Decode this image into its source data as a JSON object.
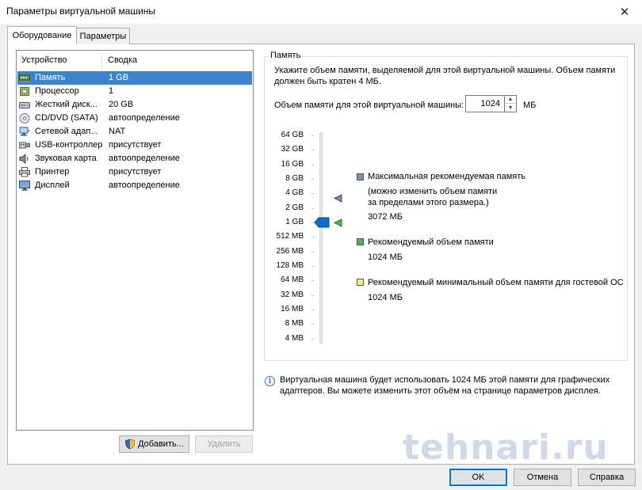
{
  "window": {
    "title": "Параметры виртуальной машины",
    "close_glyph": "✕"
  },
  "tabs": [
    {
      "label": "Оборудование"
    },
    {
      "label": "Параметры"
    }
  ],
  "device_list": {
    "columns": {
      "device": "Устройство",
      "summary": "Сводка"
    },
    "rows": [
      {
        "name": "Память",
        "summary": "1 GB",
        "icon": "memory-icon",
        "selected": true
      },
      {
        "name": "Процессор",
        "summary": "1",
        "icon": "cpu-icon"
      },
      {
        "name": "Жесткий диск...",
        "summary": "20 GB",
        "icon": "hard-disk-icon"
      },
      {
        "name": "CD/DVD (SATA)",
        "summary": "автоопределение",
        "icon": "cd-dvd-icon"
      },
      {
        "name": "Сетевой адап...",
        "summary": "NAT",
        "icon": "network-adapter-icon"
      },
      {
        "name": "USB-контроллер",
        "summary": "присутствует",
        "icon": "usb-icon"
      },
      {
        "name": "Звуковая карта",
        "summary": "автоопределение",
        "icon": "sound-card-icon"
      },
      {
        "name": "Принтер",
        "summary": "присутствует",
        "icon": "printer-icon"
      },
      {
        "name": "Дисплей",
        "summary": "автоопределение",
        "icon": "display-icon"
      }
    ]
  },
  "buttons": {
    "add": "Добавить...",
    "remove": "Удалить",
    "ok": "OK",
    "cancel": "Отмена",
    "help": "Справка"
  },
  "memory": {
    "group_label": "Память",
    "description": "Укажите объем памяти, выделяемой для этой виртуальной машины. Объем памяти должен быть кратен 4 МБ.",
    "field_label": "Объем памяти для этой виртуальной машины:",
    "value": "1024",
    "unit": "МБ",
    "scale": [
      "64 GB",
      "32 GB",
      "16 GB",
      "8 GB",
      "4 GB",
      "2 GB",
      "1 GB",
      "512 MB",
      "256 MB",
      "128 MB",
      "64 MB",
      "32 MB",
      "16 MB",
      "8 MB",
      "4 MB"
    ],
    "slider_value": "1 GB",
    "legend": {
      "max": {
        "title": "Максимальная рекомендуемая память",
        "note_line1": "(можно изменить объем памяти",
        "note_line2": "за пределами этого размера.)",
        "value": "3072 МБ",
        "color": "#7d93ad"
      },
      "recommended": {
        "title": "Рекомендуемый объем памяти",
        "value": "1024 МБ",
        "color": "#47b84b"
      },
      "min": {
        "title": "Рекомендуемый минимальный объем памяти для гостевой ОС",
        "value": "1024 МБ",
        "color": "#f3ee70"
      }
    }
  },
  "info": {
    "text": "Виртуальная машина будет использовать 1024 МБ этой памяти для графических адаптеров. Вы можете изменить этот объём на странице параметров дисплея."
  },
  "watermark": "tehnari.ru",
  "colors": {
    "selection": "#3d82ce",
    "accent": "#0078d7"
  }
}
